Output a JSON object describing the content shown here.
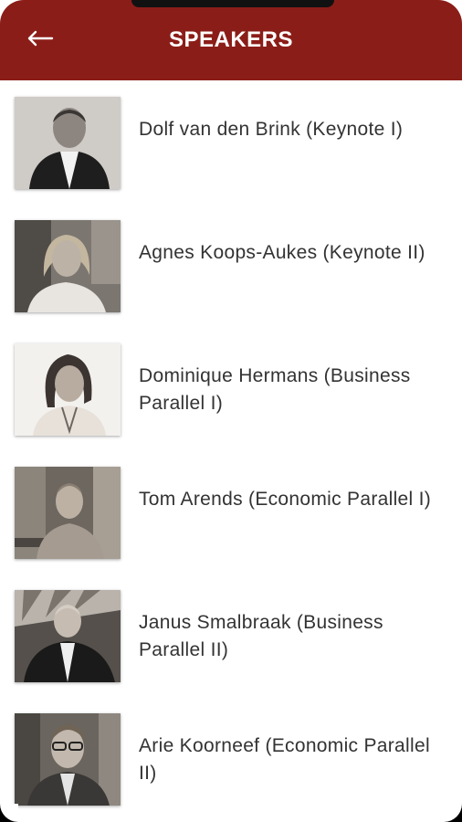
{
  "header": {
    "title": "SPEAKERS",
    "back_icon": "arrow-left-icon",
    "color": "#8b1d18"
  },
  "speakers": [
    {
      "name": "Dolf van den Brink (Keynote I)"
    },
    {
      "name": "Agnes Koops-Aukes (Keynote II)"
    },
    {
      "name": "Dominique Hermans (Business Parallel I)"
    },
    {
      "name": "Tom Arends (Economic Parallel I)"
    },
    {
      "name": "Janus Smalbraak (Business Parallel II)"
    },
    {
      "name": "Arie Koorneef (Economic Parallel II)"
    }
  ]
}
